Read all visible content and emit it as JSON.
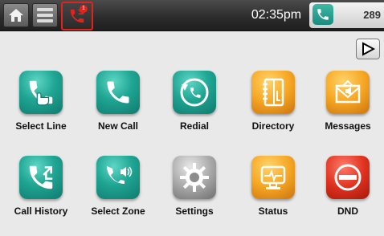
{
  "topbar": {
    "home_icon": "home-icon",
    "menu_icon": "menu-list-icon",
    "calls_icon": "phone-missed-icon",
    "calls_badge": "1",
    "time": "02:35pm",
    "line_icon": "phone-icon",
    "line_number": "289"
  },
  "page_nav": {
    "next_icon": "play-arrow-icon"
  },
  "colors": {
    "teal": "#1fa593",
    "orange": "#f6a623",
    "red": "#e0321f",
    "gray": "#a9a9a9",
    "highlight": "#e0231b"
  },
  "apps": [
    {
      "label": "Select Line",
      "icon": "phone-hand-icon",
      "color": "teal"
    },
    {
      "label": "New Call",
      "icon": "phone-icon",
      "color": "teal"
    },
    {
      "label": "Redial",
      "icon": "redial-icon",
      "color": "teal"
    },
    {
      "label": "Directory",
      "icon": "address-book-icon",
      "color": "orange"
    },
    {
      "label": "Messages",
      "icon": "voicemail-envelope-icon",
      "color": "orange"
    },
    {
      "label": "Call History",
      "icon": "call-history-icon",
      "color": "teal"
    },
    {
      "label": "Select Zone",
      "icon": "zone-speaker-icon",
      "color": "teal"
    },
    {
      "label": "Settings",
      "icon": "gear-icon",
      "color": "gray"
    },
    {
      "label": "Status",
      "icon": "monitor-status-icon",
      "color": "orange"
    },
    {
      "label": "DND",
      "icon": "do-not-disturb-icon",
      "color": "red"
    }
  ]
}
